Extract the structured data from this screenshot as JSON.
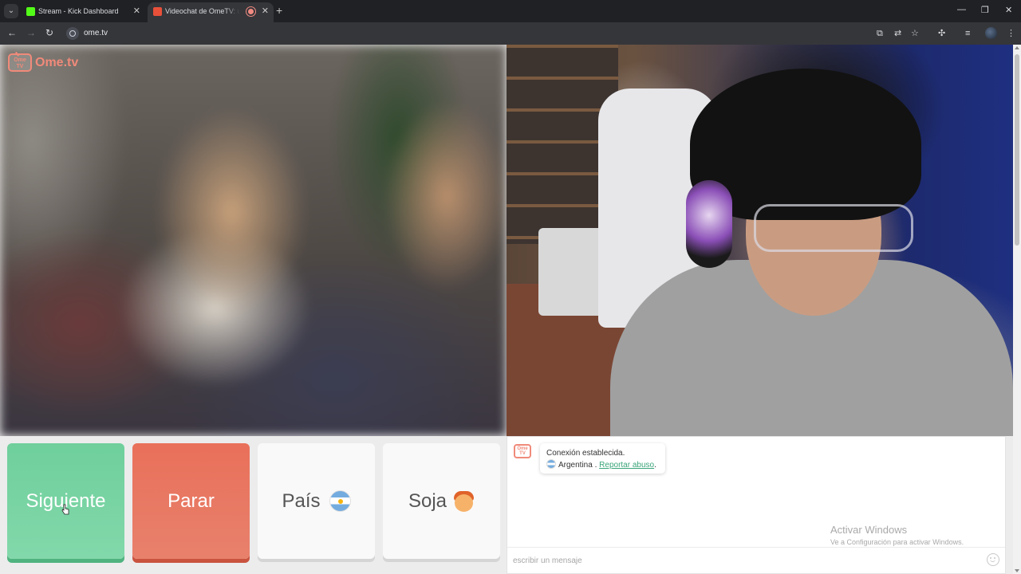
{
  "browser": {
    "tabs": [
      {
        "title": "Stream - Kick Dashboard",
        "favicon_color": "#53fc18",
        "active": false
      },
      {
        "title": "Videochat de OmeTV: una alternativa",
        "favicon_color": "#e8503a",
        "active": true,
        "recording": true
      }
    ],
    "url": "ome.tv",
    "icons": {
      "tab_search": "chevron-down-icon",
      "close_tab": "close-icon",
      "new_tab": "plus-icon",
      "back": "arrow-left-icon",
      "forward": "arrow-right-icon",
      "reload": "reload-icon",
      "site_info": "site-info-icon",
      "cast": "cast-icon",
      "translate": "translate-icon",
      "bookmark": "star-icon",
      "extensions": "puzzle-icon",
      "media": "media-control-icon",
      "menu": "kebab-menu-icon"
    }
  },
  "logo": {
    "badge_top": "Ome",
    "badge_bottom": "TV",
    "wordmark": "Ome.tv"
  },
  "controls": {
    "next": "Siguiente",
    "stop": "Parar",
    "country": "País",
    "gender": "Soja"
  },
  "chat": {
    "status": "Conexión establecida.",
    "country": "Argentina",
    "separator": " . ",
    "report_link": "Reportar abuso",
    "report_suffix": ".",
    "input_placeholder": "escribir un mensaje"
  },
  "watermark": {
    "line1": "Activar Windows",
    "line2": "Ve a Configuración para activar Windows."
  },
  "colors": {
    "next_button": "#6fcf9c",
    "stop_button": "#e9705a",
    "brand": "#f08a7a",
    "link": "#3aa57a"
  }
}
